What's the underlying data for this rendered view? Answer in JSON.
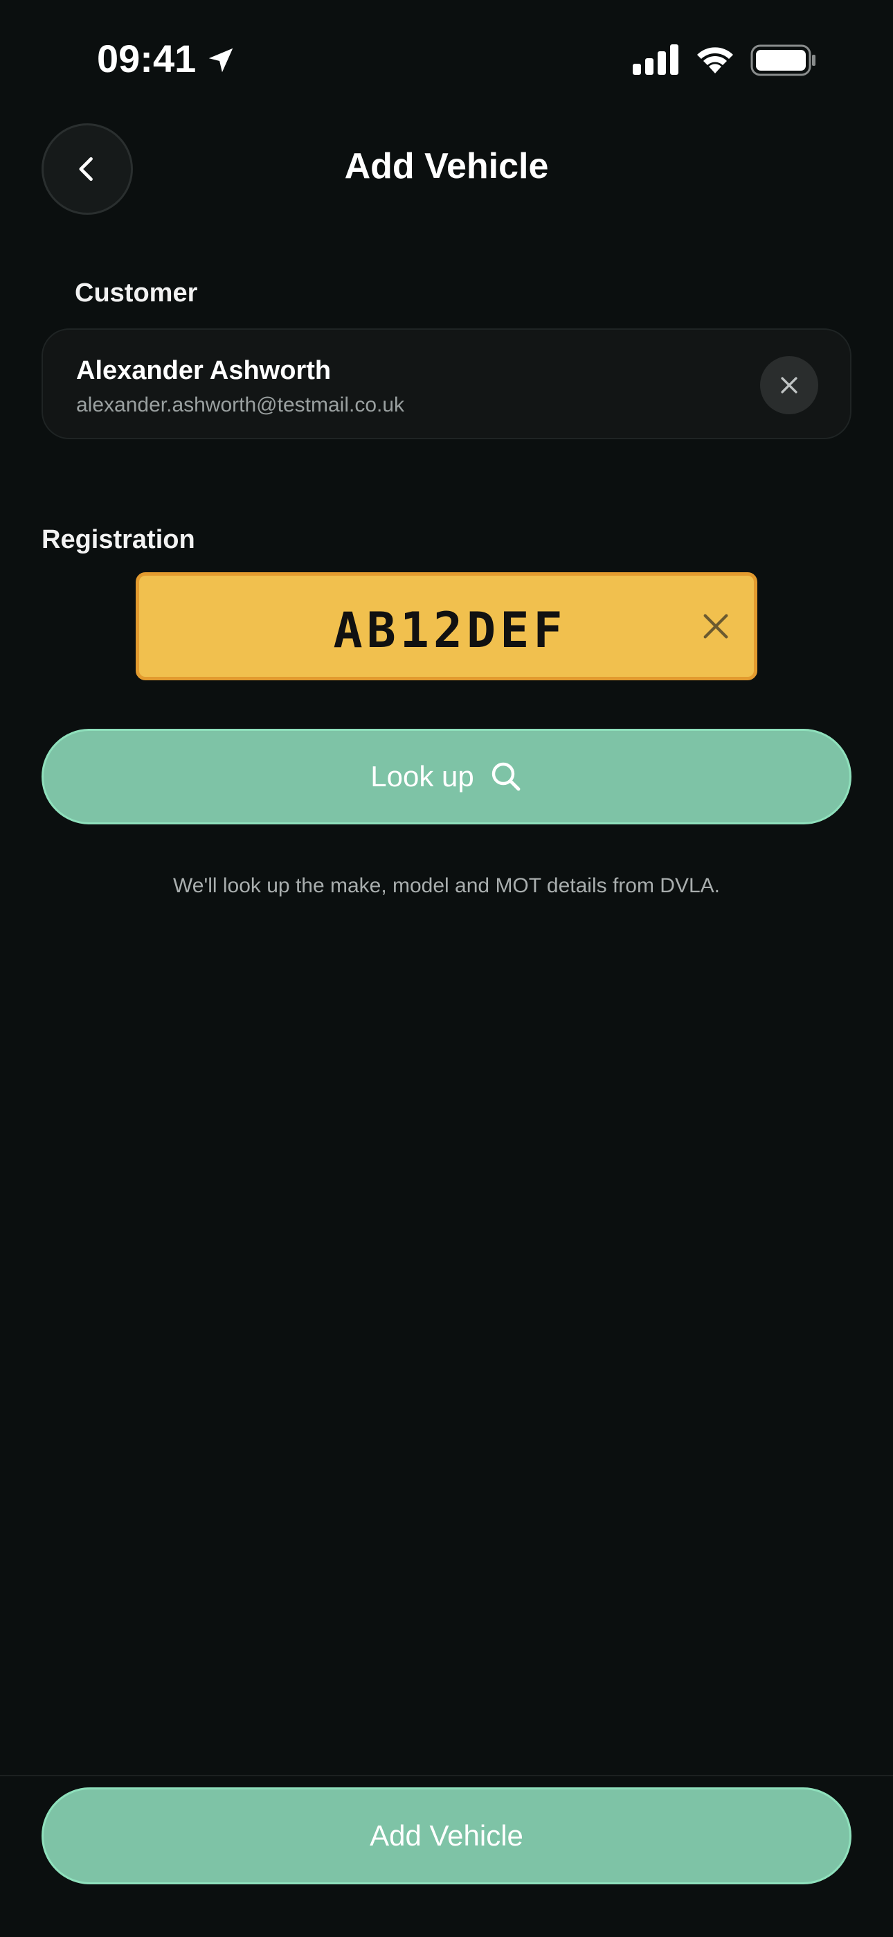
{
  "status_bar": {
    "time": "09:41"
  },
  "header": {
    "title": "Add Vehicle"
  },
  "customer": {
    "label": "Customer",
    "name": "Alexander Ashworth",
    "email": "alexander.ashworth@testmail.co.uk"
  },
  "registration": {
    "label": "Registration",
    "plate": "AB12DEF"
  },
  "lookup": {
    "button_label": "Look up",
    "helper_text": "We'll look up the make, model and MOT details from DVLA."
  },
  "footer": {
    "add_button_label": "Add Vehicle"
  },
  "colors": {
    "background": "#0b0f0f",
    "accent": "#7ec3a6",
    "plate_yellow": "#f1c04e"
  },
  "icons": {
    "location": "location-arrow-icon",
    "signal": "cellular-signal-icon",
    "wifi": "wifi-icon",
    "battery": "battery-icon",
    "back": "chevron-left-icon",
    "close": "close-icon",
    "search": "search-icon"
  }
}
